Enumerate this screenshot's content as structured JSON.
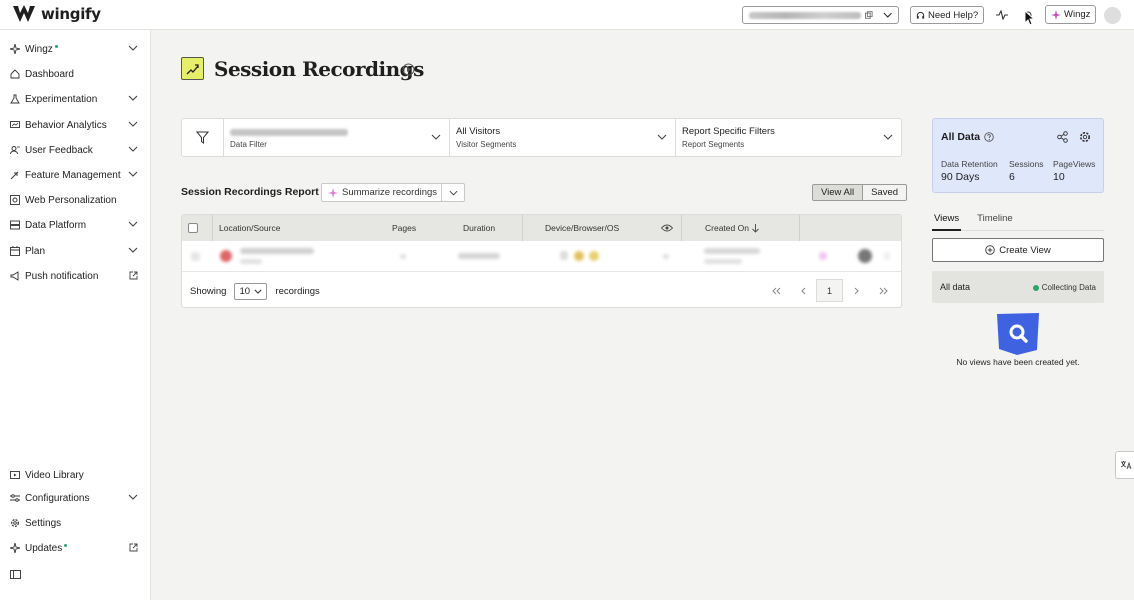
{
  "app": {
    "logo_text": "wingify"
  },
  "topbar": {
    "need_help": "Need Help?",
    "wingz": "Wingz"
  },
  "sidebar": {
    "items": [
      {
        "label": "Wingz",
        "icon": "sparkle-icon"
      },
      {
        "label": "Dashboard",
        "icon": "home-icon"
      },
      {
        "label": "Experimentation",
        "icon": "flask-icon"
      },
      {
        "label": "Behavior Analytics",
        "icon": "analytics-icon"
      },
      {
        "label": "User Feedback",
        "icon": "feedback-icon"
      },
      {
        "label": "Feature Management",
        "icon": "rocket-icon"
      },
      {
        "label": "Web Personalization",
        "icon": "target-icon"
      },
      {
        "label": "Data Platform",
        "icon": "database-icon"
      },
      {
        "label": "Plan",
        "icon": "calendar-icon"
      },
      {
        "label": "Push notification",
        "icon": "megaphone-icon"
      }
    ],
    "bottom_items": [
      {
        "label": "Video Library",
        "icon": "video-icon"
      },
      {
        "label": "Configurations",
        "icon": "config-icon"
      },
      {
        "label": "Settings",
        "icon": "gear-icon"
      },
      {
        "label": "Updates",
        "icon": "sparkle-icon"
      }
    ]
  },
  "page": {
    "title": "Session Recordings"
  },
  "filters": {
    "date_sub": "Data Filter",
    "visitors_title": "All Visitors",
    "visitors_sub": "Visitor Segments",
    "report_title": "Report Specific Filters",
    "report_sub": "Report Segments"
  },
  "report": {
    "title": "Session Recordings Report",
    "summarize": "Summarize recordings",
    "view_all": "View All",
    "saved": "Saved"
  },
  "table": {
    "columns": {
      "location": "Location/Source",
      "pages": "Pages",
      "duration": "Duration",
      "device": "Device/Browser/OS",
      "created": "Created On"
    },
    "showing": "Showing",
    "rows_per_page": "10",
    "recordings": "recordings",
    "page": "1"
  },
  "right_panel": {
    "title": "All Data",
    "stats": [
      {
        "label": "Data Retention",
        "value": "90 Days"
      },
      {
        "label": "Sessions",
        "value": "6"
      },
      {
        "label": "PageViews",
        "value": "10"
      }
    ],
    "tabs": [
      "Views",
      "Timeline"
    ],
    "create_view": "Create View",
    "data_row_name": "All data",
    "data_row_status": "Collecting Data",
    "empty_text": "No views have been created yet."
  },
  "colors": {
    "accent_yellow": "#e7ee6a",
    "panel_blue": "#dfe7fb",
    "status_green": "#2ea36c",
    "illustration_blue": "#3f63e0"
  }
}
